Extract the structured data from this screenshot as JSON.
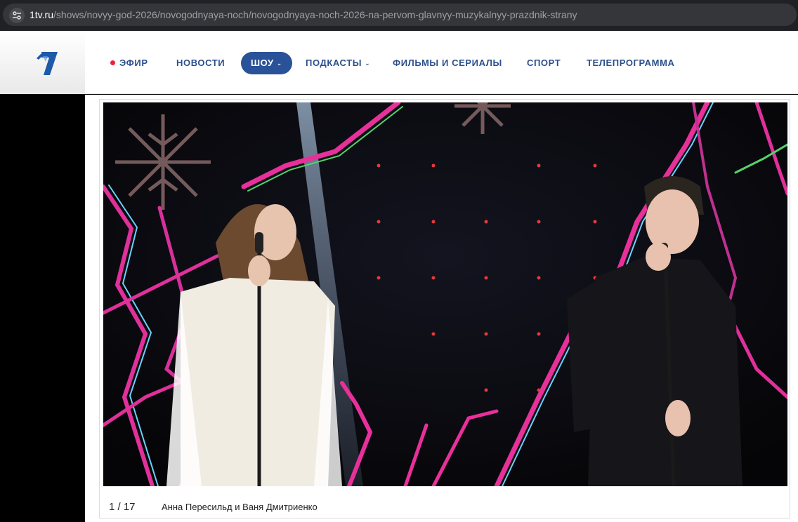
{
  "browser": {
    "url_domain": "1tv.ru",
    "url_path": "/shows/novyy-god-2026/novogodnyaya-noch/novogodnyaya-noch-2026-na-pervom-glavnyy-muzykalnyy-prazdnik-strany"
  },
  "header": {
    "logo_icon": "channel-one-logo",
    "nav": [
      {
        "label": "ЭФИР",
        "live": true
      },
      {
        "label": "НОВОСТИ"
      },
      {
        "label": "ШОУ",
        "active": true,
        "dropdown": true
      },
      {
        "label": "ПОДКАСТЫ",
        "dropdown": true
      },
      {
        "label": "ФИЛЬМЫ И СЕРИАЛЫ"
      },
      {
        "label": "СПОРТ"
      },
      {
        "label": "ТЕЛЕПРОГРАММА"
      }
    ]
  },
  "gallery": {
    "counter": "1 / 17",
    "caption": "Анна Пересильд и Ваня Дмитриенко"
  },
  "colors": {
    "nav_text": "#2b4f8c",
    "nav_active_bg": "#2a5298",
    "live_dot": "#e8243c"
  }
}
